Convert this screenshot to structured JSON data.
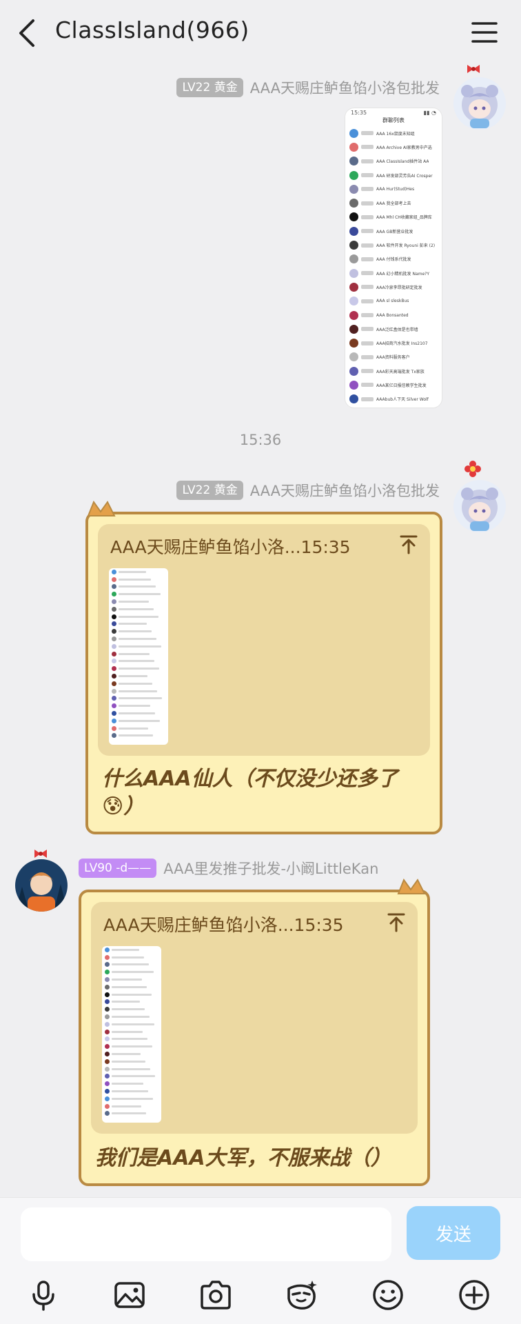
{
  "header": {
    "title": "ClassIsland(966)"
  },
  "messages": [
    {
      "level": "LV22 黄金",
      "sender": "AAA天赐庄鲈鱼馅小洛包批发",
      "type": "image",
      "screenshot": {
        "status_left": "15:35",
        "rows": [
          {
            "text": "AAA 16x鼠度未知组",
            "color": "#4a90d9"
          },
          {
            "text": "AAA Archive AI家教男中产选",
            "color": "#e06c6c"
          },
          {
            "text": "AAA ClassIsland插件站 AA",
            "color": "#5a6b8a"
          },
          {
            "text": "AAA 研发部灵芳告AI Crosper",
            "color": "#2ca85a"
          },
          {
            "text": "AAA Hur(Stud)Hes",
            "color": "#8b8bb0"
          },
          {
            "text": "AAA 我全部考上去",
            "color": "#6a6a6a"
          },
          {
            "text": "AAA Mhl CH收藏家组_品牌库",
            "color": "#111"
          },
          {
            "text": "AAA GB新营业批发",
            "color": "#3a4a9a"
          },
          {
            "text": "AAA 软件开发 Ryouni 彭来 (2)",
            "color": "#3b3b3b"
          },
          {
            "text": "AAA 付钱系代批发",
            "color": "#9a9a9a"
          },
          {
            "text": "AAA 幻小精机批发 Name?Y",
            "color": "#c0c0e0"
          },
          {
            "text": "AAA冷泉李昂批研定批发",
            "color": "#a03040"
          },
          {
            "text": "AAA sl sleskBus",
            "color": "#c8c8e8"
          },
          {
            "text": "AAA Bonsanted",
            "color": "#b03050"
          },
          {
            "text": "AAA泛红盒体是也带墙",
            "color": "#502020"
          },
          {
            "text": "AAA招商汽水批发 Ins2107",
            "color": "#7a3a20"
          },
          {
            "text": "AAA资料服务客户",
            "color": "#b8b8b8"
          },
          {
            "text": "AAA彩天高端批发 Tx家族",
            "color": "#6060b0"
          },
          {
            "text": "AAA某亿日报信赖学生批发",
            "color": "#9050c0"
          },
          {
            "text": "AAAbub人下天 Silver Wolf",
            "color": "#3050a0"
          }
        ]
      }
    },
    {
      "level": "LV22 黄金",
      "sender": "AAA天赐庄鲈鱼馅小洛包批发",
      "type": "quote",
      "quote_header": "AAA天赐庄鲈鱼馅小洛...15:35",
      "text": "什么AAA仙人（不仅没少还多了😰）"
    },
    {
      "level": "LV90 -d——",
      "sender": "AAA里发推子批发-小阚LittleKan",
      "type": "quote",
      "quote_header": "AAA天赐庄鲈鱼馅小洛...15:35",
      "text": "我们是AAA大军，不服来战（）"
    }
  ],
  "timestamp": "15:36",
  "input": {
    "placeholder": "",
    "send_label": "发送"
  },
  "toolbar": {
    "icons": [
      "microphone-icon",
      "image-icon",
      "camera-icon",
      "sticker-icon",
      "emoji-icon",
      "plus-icon"
    ]
  },
  "colors": {
    "background": "#efeff1",
    "bubble_fill": "#fdf1b8",
    "bubble_border": "#b98a42",
    "quote_fill": "#ecd9a2",
    "send_button": "#9ad3fb",
    "badge_gray": "#b3b3b3",
    "badge_purple": "#c38cf5"
  }
}
